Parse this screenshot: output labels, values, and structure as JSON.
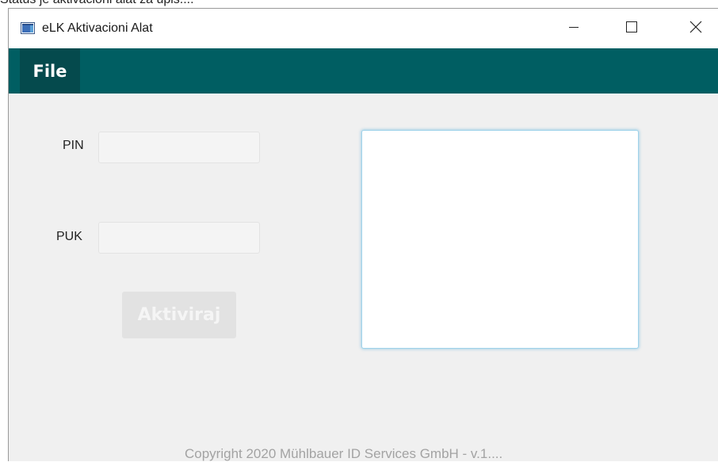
{
  "background_window": {
    "partial_text": "Status je aktivacioni alat za upis...."
  },
  "window": {
    "title": "eLK Aktivacioni Alat",
    "icon": "app-window-icon",
    "controls": {
      "minimize_icon": "minimize-icon",
      "maximize_icon": "maximize-icon",
      "close_icon": "close-icon"
    }
  },
  "menu": {
    "file_label": "File",
    "bar_color": "#005e62"
  },
  "form": {
    "pin_label": "PIN",
    "pin_value": "",
    "puk_label": "PUK",
    "puk_value": "",
    "activate_label": "Aktiviraj",
    "activate_enabled": false
  },
  "output": {
    "text": ""
  },
  "footer": {
    "copyright": "Copyright 2020 Mühlbauer ID Services GmbH - v.1...."
  }
}
